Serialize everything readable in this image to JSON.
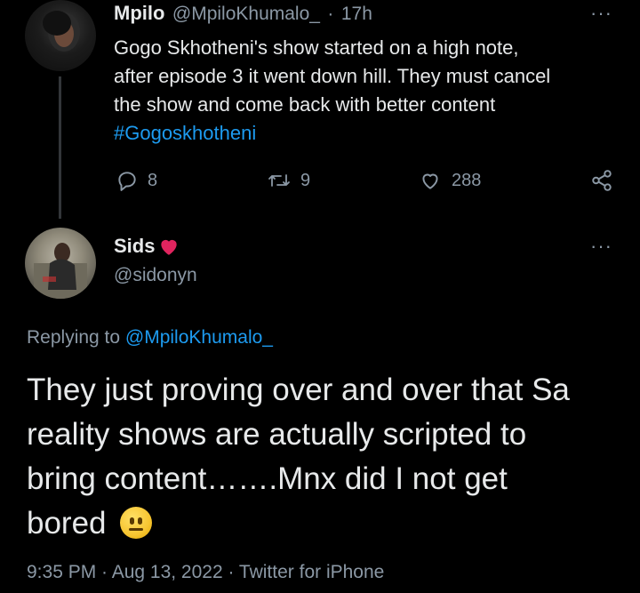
{
  "tweet1": {
    "name": "Mpilo",
    "handle": "@MpiloKhumalo_",
    "dot": "·",
    "time": "17h",
    "text_lines": [
      "Gogo Skhotheni's show started on a high note,",
      "after episode 3 it went down hill. They must cancel",
      "the show and come back with better content"
    ],
    "hashtag": "#Gogoskhotheni",
    "replies": "8",
    "retweets": "9",
    "likes": "288",
    "more": "···"
  },
  "tweet2": {
    "name": "Sids",
    "handle": "@sidonyn",
    "more": "···",
    "replying_prefix": "Replying to ",
    "replying_to": "@MpiloKhumalo_",
    "text_lines": [
      "They just proving over and over that Sa",
      "reality shows are actually scripted to",
      "bring content…….Mnx did I not get",
      "bored"
    ],
    "timestamp": "9:35 PM · Aug 13, 2022 · Twitter for iPhone"
  },
  "colors": {
    "background": "#000000",
    "text": "#e7e9ea",
    "muted": "#8b98a5",
    "link": "#1d9bf0",
    "heart": "#e0245e"
  },
  "icons": {
    "reply": "reply-icon",
    "retweet": "retweet-icon",
    "like": "heart-icon",
    "share": "share-icon",
    "emoji": "neutral-face-emoji"
  }
}
